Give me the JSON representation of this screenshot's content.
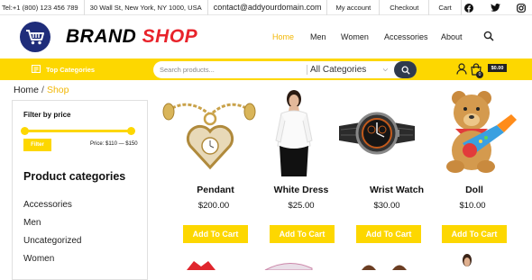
{
  "topbar": {
    "phone": "Tel:+1 (800) 123 456 789",
    "address": "30 Wall St, New York, NY 1000, USA",
    "email": "contact@addyourdomain.com",
    "links": [
      "My account",
      "Checkout",
      "Cart"
    ],
    "social": [
      "facebook-icon",
      "twitter-icon",
      "instagram-icon"
    ]
  },
  "brand": {
    "part1": "BRAND",
    "part2": "SHOP",
    "accent": "#e8232b",
    "logo_bg": "#1f2d7a"
  },
  "nav": {
    "items": [
      "Home",
      "Men",
      "Women",
      "Accessories",
      "About"
    ],
    "active": "Home"
  },
  "categories_bar": {
    "top_categories": "Top Categories",
    "search_placeholder": "Search products...",
    "select_value": "All Categories",
    "cart_count": "0",
    "cart_total": "$0.00",
    "color": "#fdd700"
  },
  "breadcrumb": {
    "home": "Home",
    "separator": "/",
    "current": "Shop"
  },
  "sidebar": {
    "filter_title": "Filter by price",
    "filter_button": "Filter",
    "price_range": "Price: $110 — $150",
    "categories_title": "Product categories",
    "categories": [
      "Accessories",
      "Men",
      "Uncategorized",
      "Women"
    ]
  },
  "products": [
    {
      "name": "Pendant",
      "price": "$200.00",
      "button": "Add To Cart"
    },
    {
      "name": "White Dress",
      "price": "$25.00",
      "button": "Add To Cart"
    },
    {
      "name": "Wrist Watch",
      "price": "$30.00",
      "button": "Add To Cart"
    },
    {
      "name": "Doll",
      "price": "$10.00",
      "button": "Add To Cart"
    }
  ]
}
